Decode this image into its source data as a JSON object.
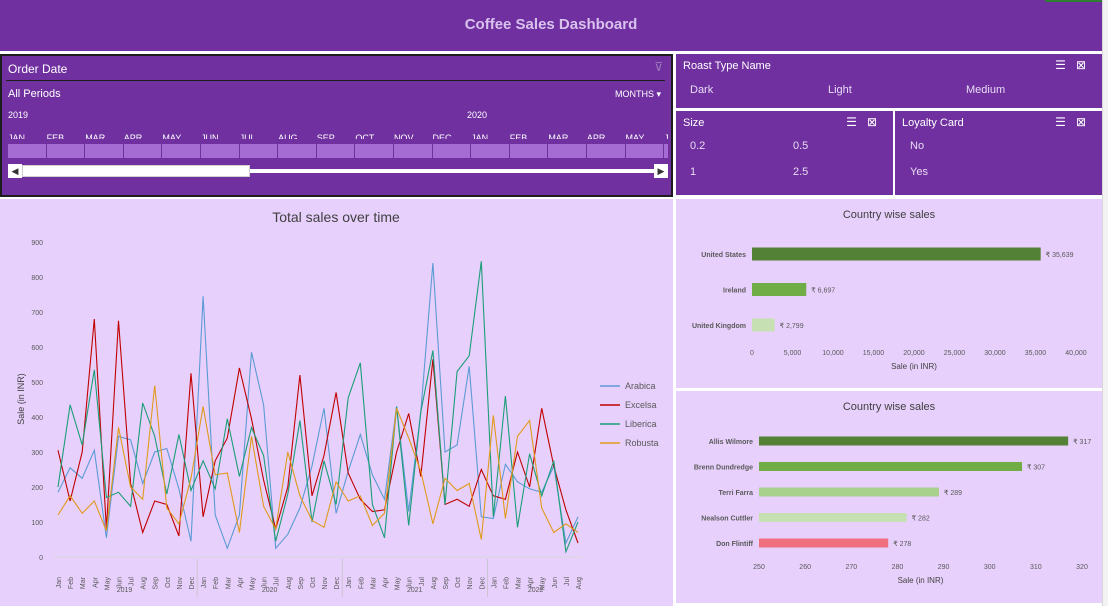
{
  "dashboard": {
    "title": "Coffee Sales Dashboard"
  },
  "timeline": {
    "title": "Order Date",
    "periods_label": "All Periods",
    "level_label": "MONTHS",
    "years": [
      "2019",
      "2020"
    ],
    "months": [
      "JAN",
      "FEB",
      "MAR",
      "APR",
      "MAY",
      "JUN",
      "JUL",
      "AUG",
      "SEP",
      "OCT",
      "NOV",
      "DEC",
      "JAN",
      "FEB",
      "MAR",
      "APR",
      "MAY",
      "JU"
    ]
  },
  "roast_slicer": {
    "title": "Roast Type Name",
    "items": [
      "Dark",
      "Light",
      "Medium"
    ]
  },
  "size_slicer": {
    "title": "Size",
    "items": [
      "0.2",
      "0.5",
      "1",
      "2.5"
    ]
  },
  "loyalty_slicer": {
    "title": "Loyalty Card",
    "items": [
      "No",
      "Yes"
    ]
  },
  "icons": {
    "multiselect": "multi-select-icon",
    "clear": "clear-filter-icon",
    "dropdown": "chevron-down-icon"
  },
  "chart_data": [
    {
      "type": "line",
      "title": "Total sales over time",
      "ylabel": "Sale (in INR)",
      "xlabel": "",
      "ylim": [
        0,
        900
      ],
      "yticks": [
        "0",
        "100",
        "200",
        "300",
        "400",
        "500",
        "600",
        "700",
        "800",
        "900"
      ],
      "x_month_labels": [
        "Jan",
        "Feb",
        "Mar",
        "Apr",
        "May",
        "Jun",
        "Jul",
        "Aug",
        "Sep",
        "Oct",
        "Nov",
        "Dec"
      ],
      "x_years": [
        "2019",
        "2020",
        "2021",
        "2022"
      ],
      "months_count": 44,
      "legend": "right",
      "series": [
        {
          "name": "Arabica",
          "color": "#5b9bd5",
          "values": [
            185,
            255,
            225,
            305,
            55,
            345,
            335,
            210,
            300,
            310,
            195,
            45,
            745,
            120,
            25,
            120,
            585,
            435,
            25,
            65,
            140,
            260,
            425,
            125,
            245,
            350,
            235,
            165,
            430,
            130,
            415,
            840,
            300,
            320,
            545,
            115,
            110,
            265,
            215,
            195,
            185,
            260,
            40,
            115
          ]
        },
        {
          "name": "Excelsa",
          "color": "#c00000",
          "values": [
            305,
            160,
            300,
            680,
            80,
            675,
            210,
            70,
            160,
            150,
            60,
            525,
            115,
            275,
            340,
            540,
            395,
            220,
            80,
            200,
            520,
            175,
            290,
            470,
            240,
            165,
            130,
            135,
            300,
            410,
            230,
            565,
            150,
            165,
            145,
            250,
            175,
            165,
            300,
            200,
            425,
            260,
            135,
            40
          ]
        },
        {
          "name": "Liberica",
          "color": "#1b9e77",
          "values": [
            200,
            435,
            320,
            535,
            170,
            185,
            145,
            440,
            345,
            180,
            350,
            190,
            275,
            195,
            395,
            230,
            370,
            290,
            45,
            180,
            390,
            100,
            275,
            150,
            455,
            555,
            150,
            55,
            430,
            90,
            415,
            590,
            150,
            530,
            575,
            845,
            115,
            460,
            85,
            295,
            175,
            275,
            15,
            100
          ]
        },
        {
          "name": "Robusta",
          "color": "#e09a1b",
          "values": [
            120,
            175,
            125,
            160,
            75,
            370,
            200,
            165,
            490,
            140,
            95,
            225,
            430,
            235,
            240,
            70,
            345,
            145,
            80,
            300,
            175,
            105,
            85,
            215,
            160,
            175,
            90,
            125,
            425,
            340,
            245,
            95,
            225,
            190,
            210,
            50,
            405,
            110,
            345,
            390,
            140,
            70,
            95,
            70
          ]
        }
      ]
    },
    {
      "type": "bar",
      "orientation": "horizontal",
      "title": "Country wise sales",
      "xlabel": "Sale (in INR)",
      "xlim": [
        0,
        40000
      ],
      "xticks": [
        "0",
        "5,000",
        "10,000",
        "15,000",
        "20,000",
        "25,000",
        "30,000",
        "35,000",
        "40,000"
      ],
      "categories": [
        "United States",
        "Ireland",
        "United Kingdom"
      ],
      "values": [
        35639,
        6697,
        2799
      ],
      "value_labels": [
        "₹ 35,639",
        "₹ 6,697",
        "₹ 2,799"
      ],
      "colors": [
        "#538135",
        "#70ad47",
        "#c6e0b4"
      ]
    },
    {
      "type": "bar",
      "orientation": "horizontal",
      "title": "Country wise sales",
      "xlabel": "Sale (in INR)",
      "xlim": [
        250,
        320
      ],
      "xticks": [
        "250",
        "260",
        "270",
        "280",
        "290",
        "300",
        "310",
        "320"
      ],
      "categories": [
        "Allis Wilmore",
        "Brenn Dundredge",
        "Terri Farra",
        "Nealson Cuttler",
        "Don Flintiff"
      ],
      "values": [
        317,
        307,
        289,
        282,
        278
      ],
      "value_labels": [
        "₹ 317",
        "₹ 307",
        "₹ 289",
        "₹ 282",
        "₹ 278"
      ],
      "colors": [
        "#538135",
        "#70ad47",
        "#a9d18e",
        "#c6e0b4",
        "#f07080"
      ]
    }
  ]
}
